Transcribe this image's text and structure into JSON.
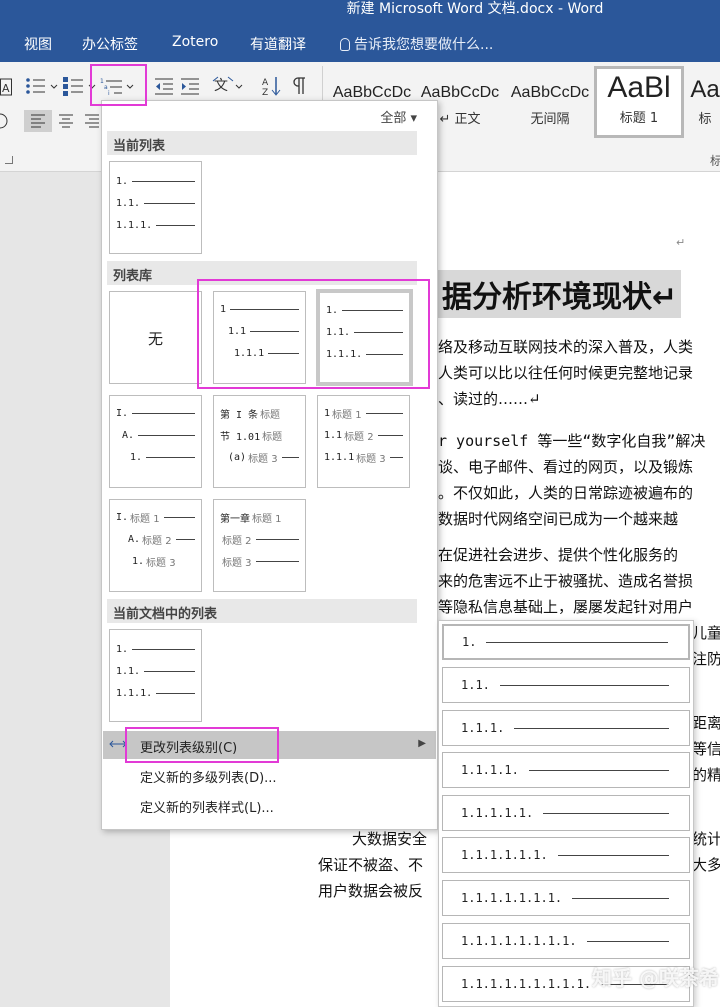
{
  "window": {
    "title": "新建 Microsoft Word 文档.docx  -  Word",
    "tabs": [
      "视图",
      "办公标签",
      "Zotero",
      "有道翻译"
    ],
    "tell_me": "告诉我您想要做什么..."
  },
  "styles": [
    {
      "sample": "AaBbCcDc",
      "name": ""
    },
    {
      "sample": "AaBbCcDc",
      "name": "↵ 正文"
    },
    {
      "sample": "AaBbCcDc",
      "name": "无间隔"
    },
    {
      "sample": "AaBl",
      "name": "标题 1"
    },
    {
      "sample": "Aa",
      "name": "标"
    }
  ],
  "ribbon_group_label": "标",
  "panel": {
    "filter": "全部 ▾",
    "sections": {
      "current": "当前列表",
      "library": "列表库",
      "in_doc": "当前文档中的列表"
    },
    "none_label": "无",
    "current_list": [
      "1.",
      "1.1.",
      "1.1.1."
    ],
    "library": [
      [
        "1",
        "1.1",
        "1.1.1"
      ],
      [
        "1.",
        "1.1.",
        "1.1.1."
      ],
      [
        "I.",
        "A.",
        "1."
      ],
      [
        [
          "第 I 条",
          "标题"
        ],
        [
          "节 1.01",
          "标题"
        ],
        [
          "(a)",
          "标题 3"
        ]
      ],
      [
        [
          "1",
          "标题 1"
        ],
        [
          "1.1",
          "标题 2"
        ],
        [
          "1.1.1",
          "标题 3"
        ]
      ],
      [
        [
          "I.",
          "标题 1"
        ],
        [
          "A.",
          "标题 2"
        ],
        [
          "1.",
          "标题 3"
        ]
      ],
      [
        [
          "第一章",
          "标题 1"
        ],
        [
          "",
          "标题 2"
        ],
        [
          "",
          "标题 3"
        ]
      ]
    ],
    "doc_list": [
      "1.",
      "1.1.",
      "1.1.1."
    ],
    "menu": {
      "change_level": "更改列表级别(C)",
      "define_multilevel": "定义新的多级列表(D)...",
      "define_style": "定义新的列表样式(L)..."
    }
  },
  "levels": [
    "1.",
    "1.1.",
    "1.1.1.",
    "1.1.1.1.",
    "1.1.1.1.1.",
    "1.1.1.1.1.1.",
    "1.1.1.1.1.1.1.",
    "1.1.1.1.1.1.1.1.",
    "1.1.1.1.1.1.1.1.1."
  ],
  "document": {
    "heading": "据分析环境现状↵",
    "lines": [
      "络及移动互联网技术的深入普及，人类",
      "人类可以比以往任何时候更完整地记录",
      "、读过的……↵",
      "r yourself 等一些“数字化自我”解决",
      "谈、电子邮件、看过的网页，以及锻炼",
      "。不仅如此，人类的日常踪迹被遍布的",
      "数据时代网络空间已成为一个越来越",
      "在促进社会进步、提供个性化服务的",
      "来的危害远不止于被骚扰、造成名誉损",
      "等隐私信息基础上，屡屡发起针对用户",
      "儿童",
      "注防",
      "距离者",
      "等信",
      "的精准",
      "大数据安全",
      "保证不被盗、不",
      "用户数据会被反",
      "统计集",
      "大多"
    ]
  },
  "watermark": "知乎 @咲茶希"
}
